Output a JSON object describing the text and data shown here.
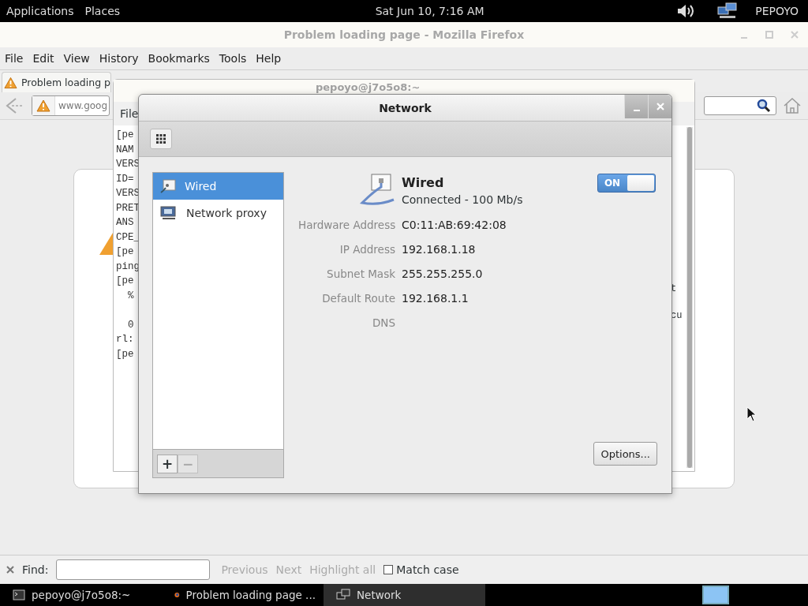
{
  "top_panel": {
    "menus": [
      "Applications",
      "Places"
    ],
    "clock": "Sat Jun 10,  7:16 AM",
    "user": "PEPOYO"
  },
  "firefox": {
    "title": "Problem loading page - Mozilla Firefox",
    "menu": [
      "File",
      "Edit",
      "View",
      "History",
      "Bookmarks",
      "Tools",
      "Help"
    ],
    "tab": "Problem loading p",
    "url": "www.goog",
    "find_bar": {
      "label": "Find:",
      "buttons": [
        {
          "label": "Previous",
          "disabled": true
        },
        {
          "label": "Next",
          "disabled": true
        },
        {
          "label": "Highlight all",
          "disabled": true
        }
      ],
      "match_case": {
        "label": "Match case",
        "checked": false
      }
    }
  },
  "terminal": {
    "title": "pepoyo@j7o5o8:~",
    "menu": "File",
    "lines": [
      {
        "text": "[pe"
      },
      {
        "text": "NAM"
      },
      {
        "text": "VERS"
      },
      {
        "text": "ID="
      },
      {
        "text": "VERS"
      },
      {
        "text": "PRET"
      },
      {
        "text": "ANS"
      },
      {
        "text": "CPE_"
      },
      {
        "text": "[pe"
      },
      {
        "text": "ping"
      },
      {
        "text": "[pe"
      },
      {
        "text": "  %"
      },
      {
        "text": "  0",
        "gap_before": true
      },
      {
        "text": "rl:"
      },
      {
        "text": "[pe"
      }
    ],
    "right_fragments": [
      "t",
      "cu"
    ]
  },
  "network": {
    "title": "Network",
    "items": [
      {
        "label": "Wired",
        "kind": "wired",
        "selected": true
      },
      {
        "label": "Network proxy",
        "kind": "proxy",
        "selected": false
      }
    ],
    "device": {
      "name": "Wired",
      "status": "Connected - 100 Mb/s",
      "on": true,
      "on_label": "ON"
    },
    "details": [
      {
        "label": "Hardware Address",
        "value": "C0:11:AB:69:42:08"
      },
      {
        "label": "IP Address",
        "value": "192.168.1.18"
      },
      {
        "label": "Subnet Mask",
        "value": "255.255.255.0"
      },
      {
        "label": "Default Route",
        "value": "192.168.1.1"
      },
      {
        "label": "DNS"
      }
    ],
    "add": "+",
    "remove": "−",
    "options_button": "Options..."
  },
  "taskbar": [
    {
      "label": "pepoyo@j7o5o8:~",
      "kind": "terminal",
      "selected": false
    },
    {
      "label": "Problem loading page ...",
      "kind": "browser",
      "selected": false
    },
    {
      "label": "Network",
      "kind": "network",
      "selected": true
    }
  ]
}
